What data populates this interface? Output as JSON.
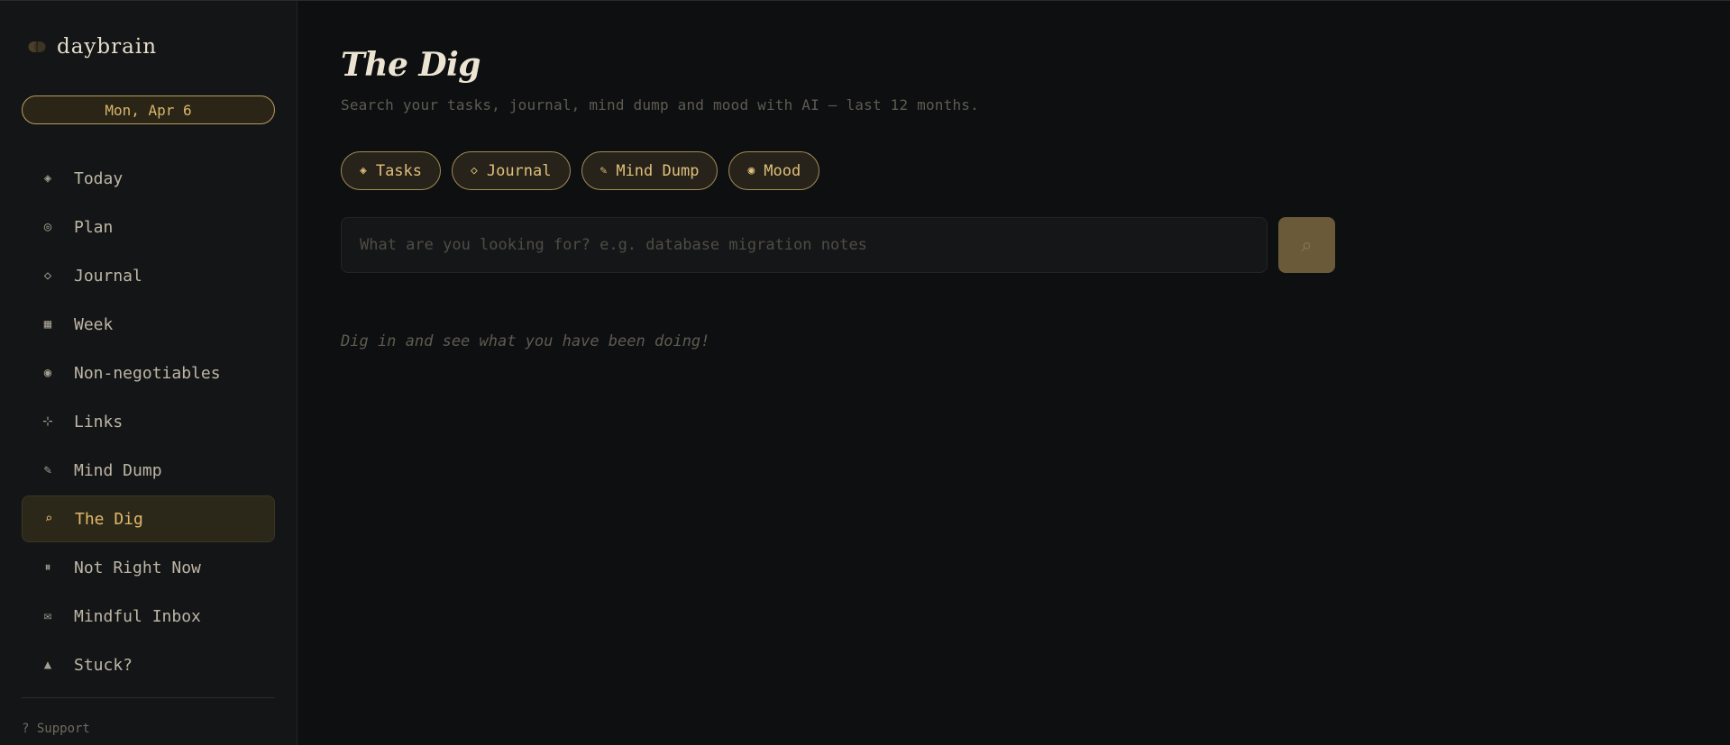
{
  "brand": {
    "name": "daybrain",
    "icon": "brain-icon"
  },
  "date": "Mon, Apr 6",
  "nav": [
    {
      "icon": "◈",
      "icon_name": "today-icon",
      "label": "Today"
    },
    {
      "icon": "◎",
      "icon_name": "plan-icon",
      "label": "Plan"
    },
    {
      "icon": "◇",
      "icon_name": "journal-icon",
      "label": "Journal"
    },
    {
      "icon": "▦",
      "icon_name": "week-icon",
      "label": "Week"
    },
    {
      "icon": "◉",
      "icon_name": "non-negotiables-icon",
      "label": "Non-negotiables"
    },
    {
      "icon": "⊹",
      "icon_name": "links-icon",
      "label": "Links"
    },
    {
      "icon": "✎",
      "icon_name": "mind-dump-icon",
      "label": "Mind Dump"
    },
    {
      "icon": "⌕",
      "icon_name": "search-icon",
      "label": "The Dig",
      "active": true
    },
    {
      "icon": "⏸",
      "icon_name": "pause-icon",
      "label": "Not Right Now"
    },
    {
      "icon": "✉",
      "icon_name": "mail-icon",
      "label": "Mindful Inbox"
    },
    {
      "icon": "▲",
      "icon_name": "triangle-icon",
      "label": "Stuck?"
    }
  ],
  "support": "? Support",
  "main": {
    "title": "The Dig",
    "subtitle": "Search your tasks, journal, mind dump and mood with AI — last 12 months.",
    "chips": [
      {
        "icon": "◈",
        "label": "Tasks"
      },
      {
        "icon": "◇",
        "label": "Journal"
      },
      {
        "icon": "✎",
        "label": "Mind Dump"
      },
      {
        "icon": "◉",
        "label": "Mood"
      }
    ],
    "search": {
      "placeholder": "What are you looking for? e.g. database migration notes",
      "value": "",
      "button_icon": "⌕"
    },
    "empty_message": "Dig in and see what you have been doing!"
  },
  "colors": {
    "accent": "#e2b868",
    "background": "#0e0f10",
    "sidebar": "#141516"
  }
}
